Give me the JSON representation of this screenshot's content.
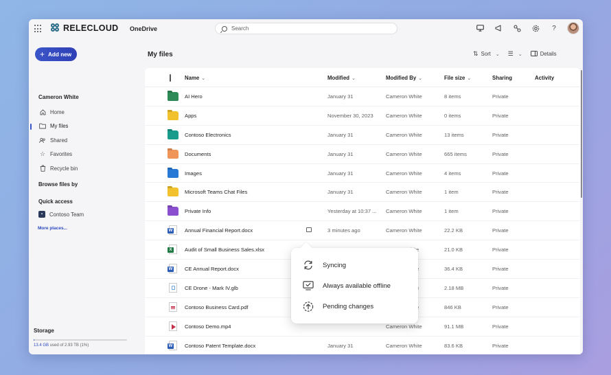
{
  "header": {
    "brand": "RELECLOUD",
    "app": "OneDrive",
    "search_placeholder": "Search"
  },
  "sidebar": {
    "add_new": "Add new",
    "user": "Cameron White",
    "items": [
      {
        "label": "Home",
        "icon": "home-icon"
      },
      {
        "label": "My files",
        "icon": "folder-icon",
        "active": true
      },
      {
        "label": "Shared",
        "icon": "people-icon"
      },
      {
        "label": "Favorites",
        "icon": "star-icon"
      },
      {
        "label": "Recycle bin",
        "icon": "recycle-bin-icon"
      }
    ],
    "browse_by": "Browse files by",
    "quick_access": "Quick access",
    "team": "Contoso Team",
    "more_places": "More places...",
    "storage_title": "Storage",
    "storage_used": "13.4 GB",
    "storage_rest": " used of 2.93 TB (1%)",
    "storage_fraction": 0.01
  },
  "main": {
    "title": "My files",
    "sort_label": "Sort",
    "details_label": "Details",
    "columns": {
      "name": "Name",
      "modified": "Modified",
      "modified_by": "Modified By",
      "file_size": "File size",
      "sharing": "Sharing",
      "activity": "Activity"
    },
    "rows": [
      {
        "name": "AI Hero",
        "modified": "January 31",
        "by": "Cameron White",
        "size": "8 items",
        "sharing": "Private",
        "kind": "folder",
        "color": "#2e8b57"
      },
      {
        "name": "Apps",
        "modified": "November 30, 2023",
        "by": "Cameron White",
        "size": "0 items",
        "sharing": "Private",
        "kind": "folder",
        "color": "#f2c12e"
      },
      {
        "name": "Contoso Electronics",
        "modified": "January 31",
        "by": "Cameron White",
        "size": "13 items",
        "sharing": "Private",
        "kind": "folder",
        "color": "#1a9c8c"
      },
      {
        "name": "Documents",
        "modified": "January 31",
        "by": "Cameron White",
        "size": "665 items",
        "sharing": "Private",
        "kind": "folder",
        "color": "#f0955a"
      },
      {
        "name": "Images",
        "modified": "January 31",
        "by": "Cameron White",
        "size": "4 items",
        "sharing": "Private",
        "kind": "folder",
        "color": "#2878d6"
      },
      {
        "name": "Microsoft Teams Chat Files",
        "modified": "January 31",
        "by": "Cameron White",
        "size": "1 item",
        "sharing": "Private",
        "kind": "folder",
        "color": "#f2c12e"
      },
      {
        "name": "Private Info",
        "modified": "Yesterday at 10:37 ...",
        "by": "Cameron White",
        "size": "1 item",
        "sharing": "Private",
        "kind": "folder",
        "color": "#8a4fcf"
      },
      {
        "name": "Annual Financial Report.docx",
        "modified": "3 minutes ago",
        "by": "Cameron White",
        "size": "22.2 KB",
        "sharing": "Private",
        "kind": "docx",
        "offline": true
      },
      {
        "name": "Audit of Small Business Sales.xlsx",
        "modified": "",
        "by": "hite",
        "size": "21.0 KB",
        "sharing": "Private",
        "kind": "xlsx"
      },
      {
        "name": "CE Annual Report.docx",
        "modified": "",
        "by": "hite",
        "size": "36.4 KB",
        "sharing": "Private",
        "kind": "docx"
      },
      {
        "name": "CE Drone - Mark IV.glb",
        "modified": "",
        "by": "hite",
        "size": "2.18 MB",
        "sharing": "Private",
        "kind": "glb"
      },
      {
        "name": "Contoso Business Card.pdf",
        "modified": "",
        "by": "hite",
        "size": "846 KB",
        "sharing": "Private",
        "kind": "pdf"
      },
      {
        "name": "Contoso Demo.mp4",
        "modified": "",
        "by": "Cameron White",
        "size": "91.1 MB",
        "sharing": "Private",
        "kind": "mp4"
      },
      {
        "name": "Contoso Patent Template.docx",
        "modified": "January 31",
        "by": "Cameron White",
        "size": "83.6 KB",
        "sharing": "Private",
        "kind": "docx"
      }
    ]
  },
  "popup": {
    "items": [
      {
        "label": "Syncing",
        "icon": "sync-icon"
      },
      {
        "label": "Always available offline",
        "icon": "offline-device-icon"
      },
      {
        "label": "Pending changes",
        "icon": "pending-upload-icon"
      }
    ]
  },
  "colors": {
    "accent": "#3a55c8",
    "word": "#2b5cb8",
    "excel": "#1f7a45",
    "red": "#c4314b"
  }
}
